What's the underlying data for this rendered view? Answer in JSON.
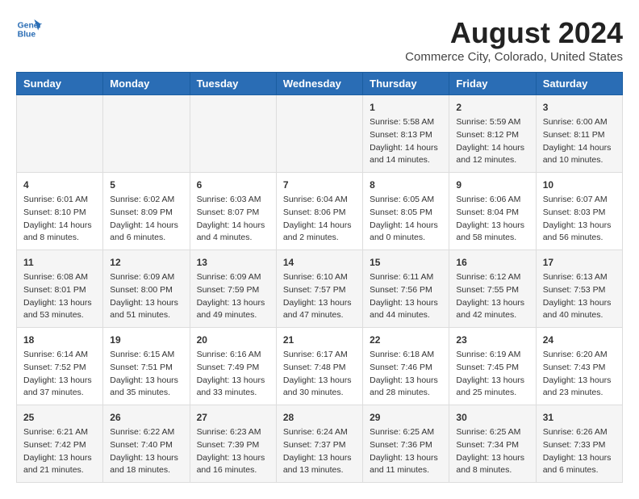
{
  "header": {
    "logo_line1": "General",
    "logo_line2": "Blue",
    "title": "August 2024",
    "subtitle": "Commerce City, Colorado, United States"
  },
  "days_of_week": [
    "Sunday",
    "Monday",
    "Tuesday",
    "Wednesday",
    "Thursday",
    "Friday",
    "Saturday"
  ],
  "weeks": [
    [
      {
        "day": "",
        "content": ""
      },
      {
        "day": "",
        "content": ""
      },
      {
        "day": "",
        "content": ""
      },
      {
        "day": "",
        "content": ""
      },
      {
        "day": "1",
        "content": "Sunrise: 5:58 AM\nSunset: 8:13 PM\nDaylight: 14 hours and 14 minutes."
      },
      {
        "day": "2",
        "content": "Sunrise: 5:59 AM\nSunset: 8:12 PM\nDaylight: 14 hours and 12 minutes."
      },
      {
        "day": "3",
        "content": "Sunrise: 6:00 AM\nSunset: 8:11 PM\nDaylight: 14 hours and 10 minutes."
      }
    ],
    [
      {
        "day": "4",
        "content": "Sunrise: 6:01 AM\nSunset: 8:10 PM\nDaylight: 14 hours and 8 minutes."
      },
      {
        "day": "5",
        "content": "Sunrise: 6:02 AM\nSunset: 8:09 PM\nDaylight: 14 hours and 6 minutes."
      },
      {
        "day": "6",
        "content": "Sunrise: 6:03 AM\nSunset: 8:07 PM\nDaylight: 14 hours and 4 minutes."
      },
      {
        "day": "7",
        "content": "Sunrise: 6:04 AM\nSunset: 8:06 PM\nDaylight: 14 hours and 2 minutes."
      },
      {
        "day": "8",
        "content": "Sunrise: 6:05 AM\nSunset: 8:05 PM\nDaylight: 14 hours and 0 minutes."
      },
      {
        "day": "9",
        "content": "Sunrise: 6:06 AM\nSunset: 8:04 PM\nDaylight: 13 hours and 58 minutes."
      },
      {
        "day": "10",
        "content": "Sunrise: 6:07 AM\nSunset: 8:03 PM\nDaylight: 13 hours and 56 minutes."
      }
    ],
    [
      {
        "day": "11",
        "content": "Sunrise: 6:08 AM\nSunset: 8:01 PM\nDaylight: 13 hours and 53 minutes."
      },
      {
        "day": "12",
        "content": "Sunrise: 6:09 AM\nSunset: 8:00 PM\nDaylight: 13 hours and 51 minutes."
      },
      {
        "day": "13",
        "content": "Sunrise: 6:09 AM\nSunset: 7:59 PM\nDaylight: 13 hours and 49 minutes."
      },
      {
        "day": "14",
        "content": "Sunrise: 6:10 AM\nSunset: 7:57 PM\nDaylight: 13 hours and 47 minutes."
      },
      {
        "day": "15",
        "content": "Sunrise: 6:11 AM\nSunset: 7:56 PM\nDaylight: 13 hours and 44 minutes."
      },
      {
        "day": "16",
        "content": "Sunrise: 6:12 AM\nSunset: 7:55 PM\nDaylight: 13 hours and 42 minutes."
      },
      {
        "day": "17",
        "content": "Sunrise: 6:13 AM\nSunset: 7:53 PM\nDaylight: 13 hours and 40 minutes."
      }
    ],
    [
      {
        "day": "18",
        "content": "Sunrise: 6:14 AM\nSunset: 7:52 PM\nDaylight: 13 hours and 37 minutes."
      },
      {
        "day": "19",
        "content": "Sunrise: 6:15 AM\nSunset: 7:51 PM\nDaylight: 13 hours and 35 minutes."
      },
      {
        "day": "20",
        "content": "Sunrise: 6:16 AM\nSunset: 7:49 PM\nDaylight: 13 hours and 33 minutes."
      },
      {
        "day": "21",
        "content": "Sunrise: 6:17 AM\nSunset: 7:48 PM\nDaylight: 13 hours and 30 minutes."
      },
      {
        "day": "22",
        "content": "Sunrise: 6:18 AM\nSunset: 7:46 PM\nDaylight: 13 hours and 28 minutes."
      },
      {
        "day": "23",
        "content": "Sunrise: 6:19 AM\nSunset: 7:45 PM\nDaylight: 13 hours and 25 minutes."
      },
      {
        "day": "24",
        "content": "Sunrise: 6:20 AM\nSunset: 7:43 PM\nDaylight: 13 hours and 23 minutes."
      }
    ],
    [
      {
        "day": "25",
        "content": "Sunrise: 6:21 AM\nSunset: 7:42 PM\nDaylight: 13 hours and 21 minutes."
      },
      {
        "day": "26",
        "content": "Sunrise: 6:22 AM\nSunset: 7:40 PM\nDaylight: 13 hours and 18 minutes."
      },
      {
        "day": "27",
        "content": "Sunrise: 6:23 AM\nSunset: 7:39 PM\nDaylight: 13 hours and 16 minutes."
      },
      {
        "day": "28",
        "content": "Sunrise: 6:24 AM\nSunset: 7:37 PM\nDaylight: 13 hours and 13 minutes."
      },
      {
        "day": "29",
        "content": "Sunrise: 6:25 AM\nSunset: 7:36 PM\nDaylight: 13 hours and 11 minutes."
      },
      {
        "day": "30",
        "content": "Sunrise: 6:25 AM\nSunset: 7:34 PM\nDaylight: 13 hours and 8 minutes."
      },
      {
        "day": "31",
        "content": "Sunrise: 6:26 AM\nSunset: 7:33 PM\nDaylight: 13 hours and 6 minutes."
      }
    ]
  ]
}
